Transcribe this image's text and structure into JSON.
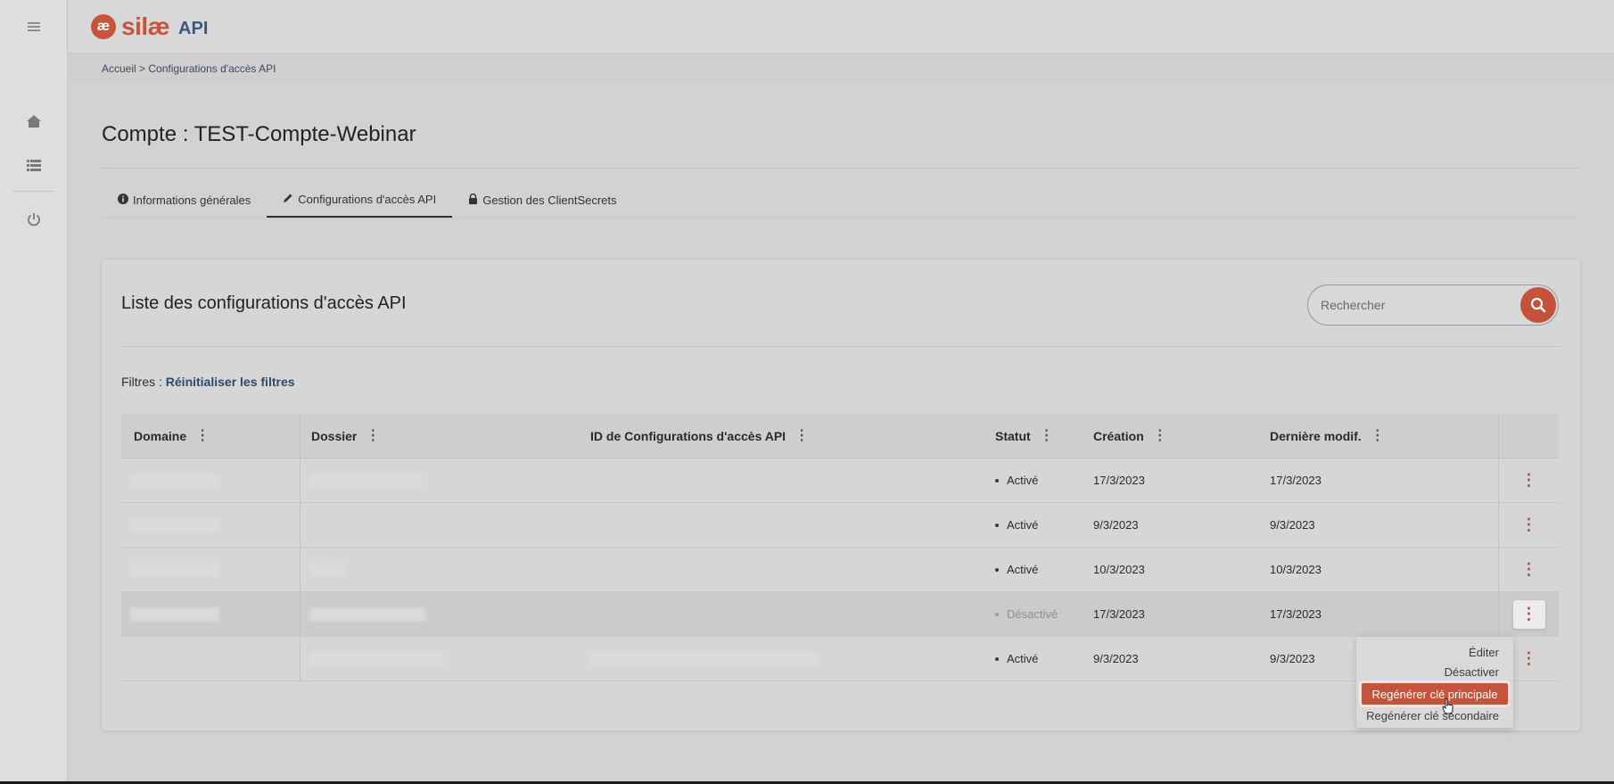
{
  "app": {
    "logo_text": "silæ",
    "logo_suffix": "API"
  },
  "breadcrumb": {
    "home": "Accueil",
    "separator": ">",
    "current": "Configurations d'accès API"
  },
  "page": {
    "title": "Compte : TEST-Compte-Webinar"
  },
  "tabs": [
    {
      "label": "Informations générales",
      "icon": "info-icon",
      "active": false
    },
    {
      "label": "Configurations d'accès API",
      "icon": "pencil-icon",
      "active": true
    },
    {
      "label": "Gestion des ClientSecrets",
      "icon": "lock-icon",
      "active": false
    }
  ],
  "list": {
    "title": "Liste des configurations d'accès API",
    "search_placeholder": "Rechercher",
    "filters_label": "Filtres :",
    "reset_filters": "Réinitialiser les filtres"
  },
  "table": {
    "columns": [
      "Domaine",
      "Dossier",
      "ID de Configurations d'accès API",
      "Statut",
      "Création",
      "Dernière modif."
    ],
    "rows": [
      {
        "statut": "Activé",
        "creation": "17/3/2023",
        "modif": "17/3/2023"
      },
      {
        "statut": "Activé",
        "creation": "9/3/2023",
        "modif": "9/3/2023"
      },
      {
        "statut": "Activé",
        "creation": "10/3/2023",
        "modif": "10/3/2023"
      },
      {
        "statut": "Désactivé",
        "creation": "17/3/2023",
        "modif": "17/3/2023"
      },
      {
        "statut": "Activé",
        "creation": "9/3/2023",
        "modif": "9/3/2023"
      }
    ]
  },
  "row_menu": {
    "edit": "Éditer",
    "disable": "Désactiver",
    "regen_primary": "Regénérer clé principale",
    "regen_secondary": "Regénérer clé secondaire"
  },
  "colors": {
    "accent": "#c6533c",
    "link": "#2b4a6a"
  }
}
